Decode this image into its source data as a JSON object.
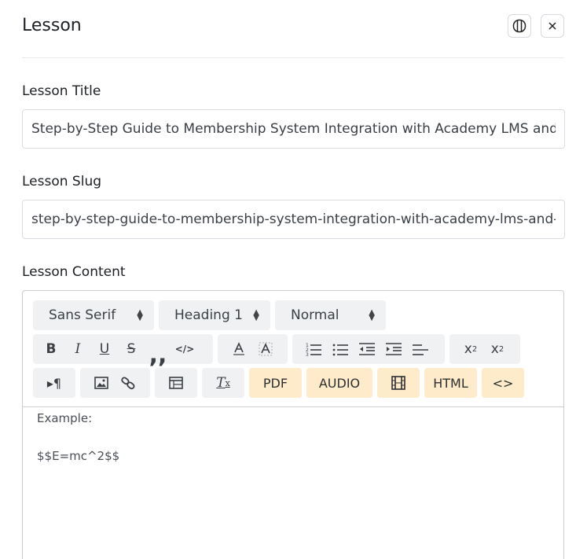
{
  "panel": {
    "title": "Lesson"
  },
  "fields": {
    "title_label": "Lesson Title",
    "title_value": "Step-by-Step Guide to Membership System Integration with Academy LMS and S",
    "slug_label": "Lesson Slug",
    "slug_value": "step-by-step-guide-to-membership-system-integration-with-academy-lms-and-",
    "content_label": "Lesson Content"
  },
  "toolbar": {
    "font": "Sans Serif",
    "heading": "Heading 1",
    "size": "Normal",
    "custom_buttons": {
      "pdf": "PDF",
      "audio": "AUDIO",
      "html": "HTML",
      "code": "<>"
    }
  },
  "editor": {
    "lines": [
      "Example:",
      "",
      "$$E=mc^2$$"
    ]
  },
  "colors": {
    "accent_button_bg": "#fdebc9",
    "toolbar_group_bg": "#f0f1f3"
  }
}
